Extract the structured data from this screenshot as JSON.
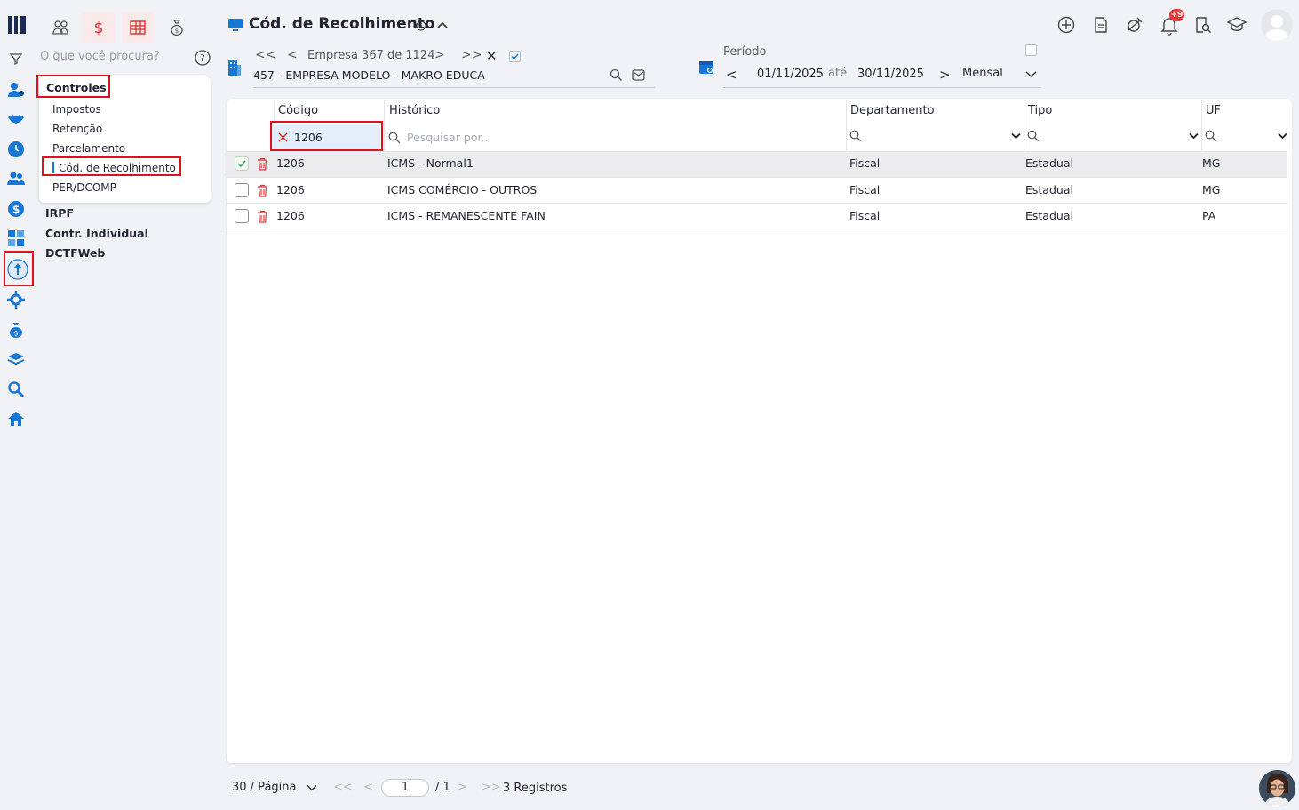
{
  "sidebar": {
    "search_placeholder": "O que você procura?",
    "menu": {
      "header": "Controles",
      "items": [
        "Impostos",
        "Retenção",
        "Parcelamento",
        "Cód. de Recolhimento",
        "PER/DCOMP"
      ],
      "selected": "Cód. de Recolhimento"
    },
    "sections": [
      "IRPF",
      "Contr. Individual",
      "DCTFWeb"
    ],
    "rail_icons": [
      "logo-icon",
      "filter-icon",
      "contacts-icon",
      "handshake-icon",
      "clock-icon",
      "users-icon",
      "dollar-icon",
      "calculator-icon",
      "tax-icon",
      "gear-network-icon",
      "money-bag-icon",
      "layers-icon",
      "search-icon",
      "home-icon"
    ]
  },
  "header": {
    "title": "Cód. de Recolhimento",
    "module_tabs": [
      "people-icon",
      "dollar-icon",
      "spreadsheet-icon",
      "money-bag-icon"
    ],
    "notification_badge": "+9"
  },
  "company": {
    "nav_label": "Empresa 367 de 1124",
    "name": "457 - EMPRESA MODELO - MAKRO EDUCA"
  },
  "period": {
    "label": "Período",
    "start": "01/11/2025",
    "until": "até",
    "end": "30/11/2025",
    "mode": "Mensal"
  },
  "table": {
    "columns": [
      "Código",
      "Histórico",
      "Departamento",
      "Tipo",
      "UF"
    ],
    "filter_codigo": "1206",
    "filter_placeholder": "Pesquisar por...",
    "rows": [
      {
        "codigo": "1206",
        "historico": "ICMS - Normal1",
        "departamento": "Fiscal",
        "tipo": "Estadual",
        "uf": "MG",
        "checked": true
      },
      {
        "codigo": "1206",
        "historico": "ICMS COMÉRCIO - OUTROS",
        "departamento": "Fiscal",
        "tipo": "Estadual",
        "uf": "MG",
        "checked": false
      },
      {
        "codigo": "1206",
        "historico": "ICMS - REMANESCENTE FAIN",
        "departamento": "Fiscal",
        "tipo": "Estadual",
        "uf": "PA",
        "checked": false
      }
    ]
  },
  "footer": {
    "per_page": "30 / Página",
    "page": "1",
    "total_pages": "/ 1",
    "records": "3 Registros"
  },
  "colors": {
    "accent": "#1877d4",
    "highlight_red": "#e0101c",
    "text": "#1f2430"
  }
}
